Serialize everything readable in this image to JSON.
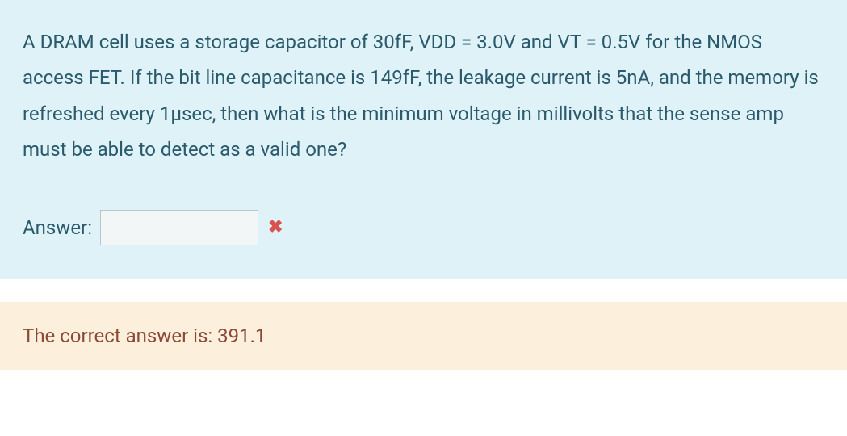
{
  "question": {
    "text": "A DRAM cell uses a storage capacitor of 30fF, VDD = 3.0V and VT = 0.5V for the NMOS access FET. If the bit line capacitance is 149fF, the leakage current is 5nA, and the memory is refreshed every 1µsec, then what is the minimum voltage in millivolts that the sense amp must be able to detect as a valid one?"
  },
  "answer": {
    "label": "Answer:",
    "value": "",
    "icon": "cross-icon"
  },
  "correct": {
    "prefix": "The correct answer is: ",
    "value": "391.1"
  }
}
